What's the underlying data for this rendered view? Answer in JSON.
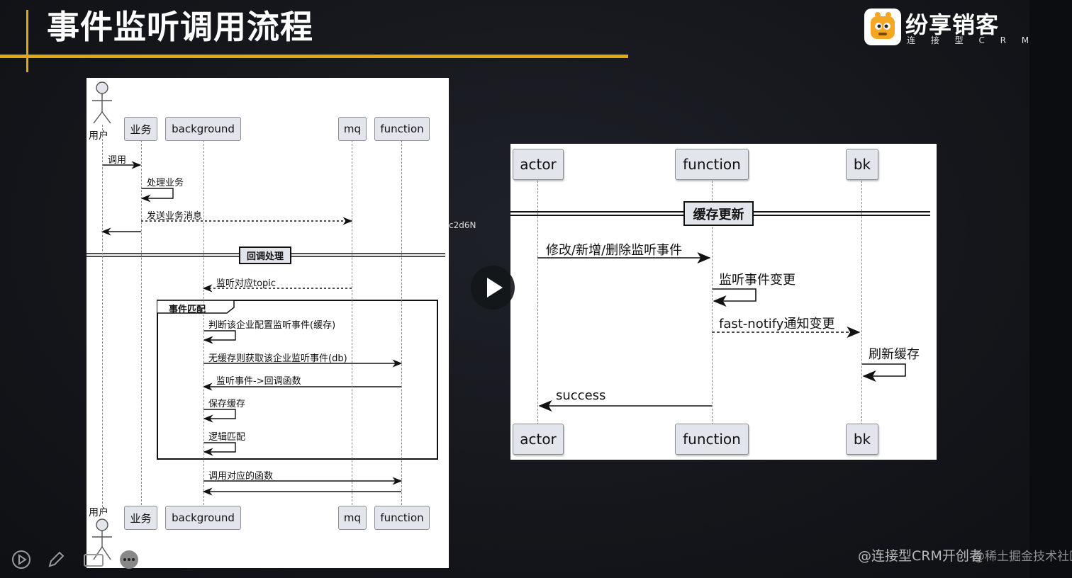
{
  "slide": {
    "title": "事件监听调用流程",
    "logo": {
      "name": "纷享销客",
      "subtitle": "连 接 型 C R M"
    }
  },
  "diagram_left": {
    "participants": [
      "业务",
      "background",
      "mq",
      "function"
    ],
    "actor": "用户",
    "messages": [
      "调用",
      "处理业务",
      "发送业务消息",
      "监听对应topic",
      "判断该企业配置监听事件(缓存)",
      "无缓存则获取该企业监听事件(db)",
      "监听事件->回调函数",
      "保存缓存",
      "逻辑匹配",
      "调用对应的函数"
    ],
    "divider": "回调处理",
    "frame_label": "事件匹配"
  },
  "diagram_right": {
    "participants": [
      "actor",
      "function",
      "bk"
    ],
    "divider": "缓存更新",
    "messages": [
      "修改/新增/删除监听事件",
      "监听事件变更",
      "fast-notify通知变更",
      "刷新缓存",
      "success"
    ]
  },
  "stray_text": "c2d6N",
  "watermark": "@连接型CRM开创者",
  "watermark_overlap": "@稀土掘金技术社区",
  "colors": {
    "accent": "#e8a317",
    "background": "#14161b"
  }
}
